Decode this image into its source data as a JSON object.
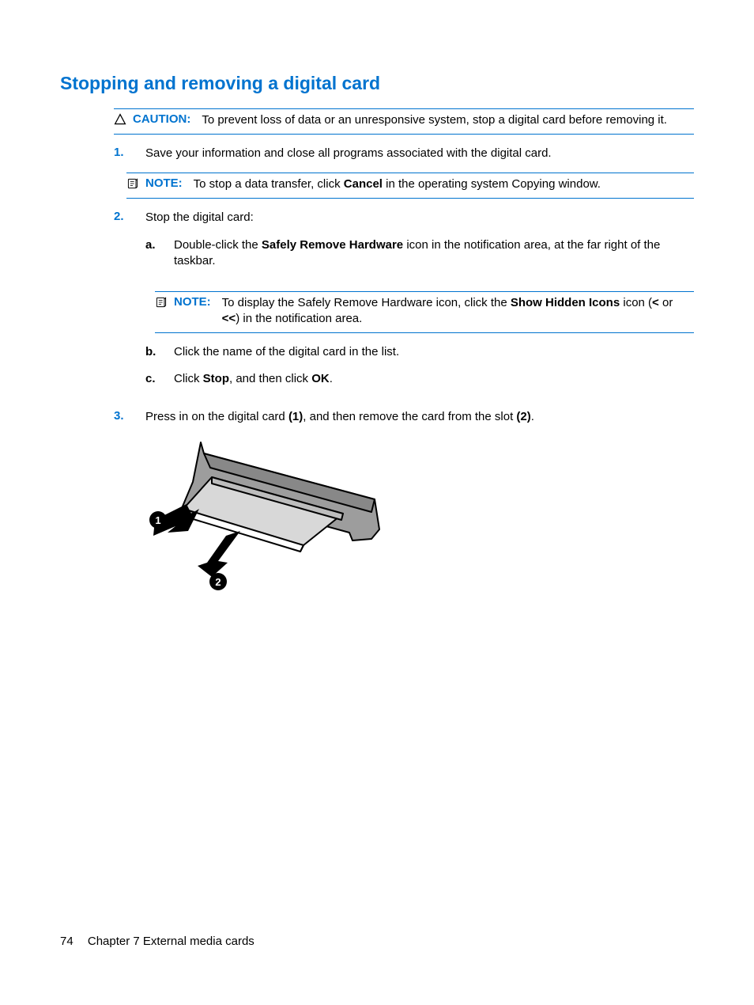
{
  "heading": "Stopping and removing a digital card",
  "caution": {
    "label": "CAUTION:",
    "text": "To prevent loss of data or an unresponsive system, stop a digital card before removing it."
  },
  "steps": {
    "s1": {
      "num": "1.",
      "text": "Save your information and close all programs associated with the digital card."
    },
    "note1": {
      "label": "NOTE:",
      "pre": "To stop a data transfer, click ",
      "bold": "Cancel",
      "post": " in the operating system Copying window."
    },
    "s2": {
      "num": "2.",
      "text": "Stop the digital card:"
    },
    "sub": {
      "a": {
        "alpha": "a.",
        "pre": "Double-click the ",
        "bold": "Safely Remove Hardware",
        "post": " icon in the notification area, at the far right of the taskbar."
      },
      "note2": {
        "label": "NOTE:",
        "pre": "To display the Safely Remove Hardware icon, click the ",
        "bold": "Show Hidden Icons",
        "post_pre": " icon (",
        "b1": "<",
        "mid": " or ",
        "b2": "<<",
        "close": ") in the notification area."
      },
      "b": {
        "alpha": "b.",
        "text": "Click the name of the digital card in the list."
      },
      "c": {
        "alpha": "c.",
        "pre": "Click ",
        "bold1": "Stop",
        "mid": ", and then click ",
        "bold2": "OK",
        "post": "."
      }
    },
    "s3": {
      "num": "3.",
      "pre": "Press in on the digital card ",
      "b1": "(1)",
      "mid": ", and then remove the card from the slot ",
      "b2": "(2)",
      "post": "."
    }
  },
  "footer": {
    "page": "74",
    "chapter": "Chapter 7   External media cards"
  }
}
